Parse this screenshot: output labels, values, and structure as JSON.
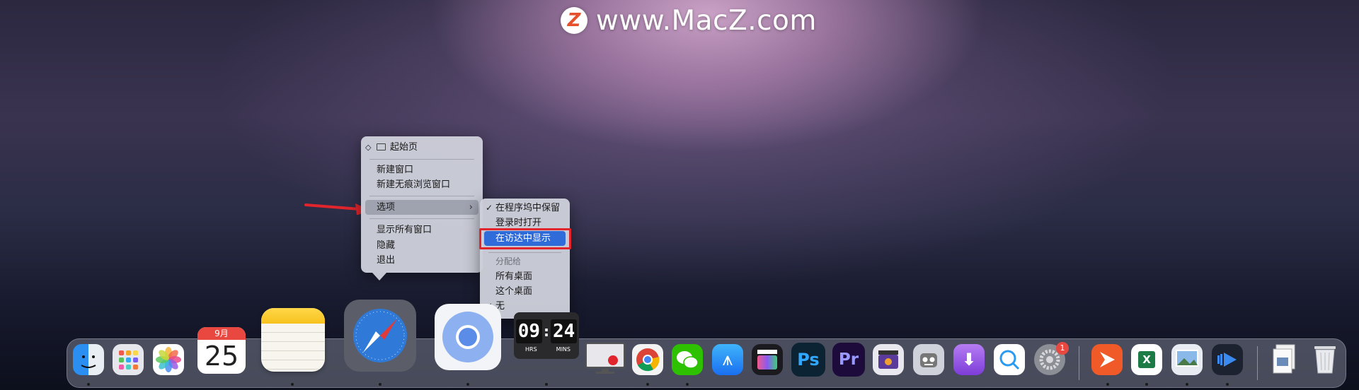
{
  "watermark": {
    "logo_letter": "Z",
    "text": "www.MacZ.com"
  },
  "context_menu": {
    "current_window": "起始页",
    "new_window": "新建窗口",
    "new_private_window": "新建无痕浏览窗口",
    "options": "选项",
    "show_all_windows": "显示所有窗口",
    "hide": "隐藏",
    "quit": "退出"
  },
  "options_submenu": {
    "keep_in_dock": "在程序坞中保留",
    "open_at_login": "登录时打开",
    "show_in_finder": "在访达中显示",
    "assign_to_header": "分配给",
    "all_desktops": "所有桌面",
    "this_desktop": "这个桌面",
    "none": "无",
    "checkmark": "✓"
  },
  "dock": {
    "calendar": {
      "month": "9月",
      "day": "25"
    },
    "clock": {
      "hours": "09",
      "minutes": "24",
      "hrs_label": "HRS",
      "mins_label": "MINS",
      "colon": ":"
    },
    "photoshop_label": "Ps",
    "premiere_label": "Pr",
    "settings_badge": "1",
    "excel_label": "X"
  },
  "colors": {
    "highlight": "#2f6bd9",
    "annotation_red": "#e0252c"
  }
}
